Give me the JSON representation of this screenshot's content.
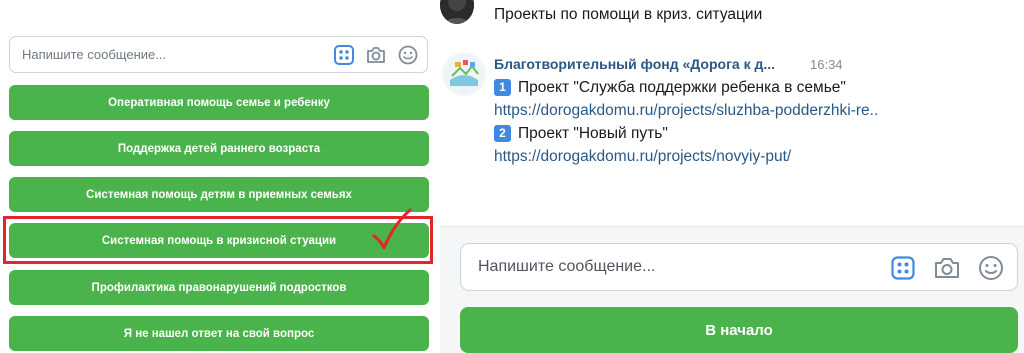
{
  "left": {
    "input_placeholder": "Напишите сообщение...",
    "quick_buttons": [
      "Оперативная помощь семье и ребенку",
      "Поддержка детей раннего возраста",
      "Системная помощь детям в приемных семьях",
      "Системная помощь в кризисной стуации",
      "Профилактика правонарушений подростков",
      "Я не нашел ответ на свой вопрос"
    ],
    "highlighted_index": 3
  },
  "chat": {
    "prev_message": "Проекты по помощи в криз. ситуации",
    "sender": "Благотворительный фонд «Дорога к д...",
    "time": "16:34",
    "lines": [
      {
        "badge": "1",
        "text": "Проект \"Служба поддержки ребенка в семье\""
      },
      {
        "link": "https://dorogakdomu.ru/projects/sluzhba-podderzhki-re.."
      },
      {
        "badge": "2",
        "text": "Проект \"Новый путь\""
      },
      {
        "link": "https://dorogakdomu.ru/projects/novyiy-put/"
      }
    ]
  },
  "composer": {
    "placeholder": "Напишите сообщение...",
    "start_button": "В начало"
  },
  "colors": {
    "button_green": "#4bb34b",
    "link_blue": "#2a5885",
    "highlight_red": "#e4262c",
    "badge_blue": "#3f8ae0"
  },
  "icons": [
    "keyboard-grid-icon",
    "camera-icon",
    "smile-icon",
    "checkmark-icon"
  ]
}
